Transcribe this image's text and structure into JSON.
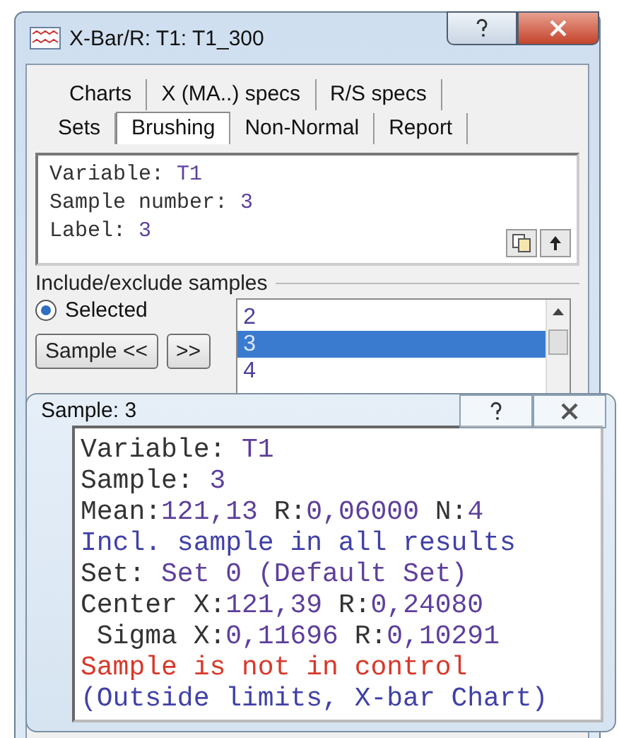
{
  "window": {
    "title": "X-Bar/R: T1: T1_300"
  },
  "tab_rows": [
    {
      "tabs": [
        {
          "label": "Charts",
          "selected": false
        },
        {
          "label": "X (MA..) specs",
          "selected": false
        },
        {
          "label": "R/S specs",
          "selected": false
        }
      ]
    },
    {
      "tabs": [
        {
          "label": "Sets",
          "selected": false
        },
        {
          "label": "Brushing",
          "selected": true
        },
        {
          "label": "Non-Normal",
          "selected": false
        },
        {
          "label": "Report",
          "selected": false
        }
      ]
    }
  ],
  "info": [
    [
      {
        "text": "Variable: ",
        "kind": "label"
      },
      {
        "text": "T1",
        "kind": "value"
      }
    ],
    [
      {
        "text": "Sample number: ",
        "kind": "label"
      },
      {
        "text": "3",
        "kind": "value"
      }
    ],
    [
      {
        "text": "Label: ",
        "kind": "label"
      },
      {
        "text": "3",
        "kind": "value"
      }
    ]
  ],
  "group": {
    "title": "Include/exclude samples",
    "radio": {
      "label": "Selected",
      "selected": true
    },
    "buttons": [
      "Sample <<",
      ">>"
    ],
    "list": [
      {
        "label": "2",
        "selected": false
      },
      {
        "label": "3",
        "selected": true
      },
      {
        "label": "4",
        "selected": false
      }
    ]
  },
  "popup": {
    "title": "Sample: 3",
    "lines": [
      [
        {
          "text": "Variable: ",
          "kind": "label"
        },
        {
          "text": "T1",
          "kind": "value"
        }
      ],
      [
        {
          "text": "Sample: ",
          "kind": "label"
        },
        {
          "text": "3",
          "kind": "value"
        }
      ],
      [
        {
          "text": "Mean:",
          "kind": "label"
        },
        {
          "text": "121,13 ",
          "kind": "value"
        },
        {
          "text": "R:",
          "kind": "label"
        },
        {
          "text": "0,06000 ",
          "kind": "value"
        },
        {
          "text": "N:",
          "kind": "label"
        },
        {
          "text": "4",
          "kind": "value"
        }
      ],
      [
        {
          "text": "Incl. sample in all results",
          "kind": "note"
        }
      ],
      [
        {
          "text": "Set: ",
          "kind": "label"
        },
        {
          "text": "Set 0 (Default Set)",
          "kind": "value"
        }
      ],
      [
        {
          "text": "Center X:",
          "kind": "label"
        },
        {
          "text": "121,39 ",
          "kind": "value"
        },
        {
          "text": "R:",
          "kind": "label"
        },
        {
          "text": "0,24080",
          "kind": "value"
        }
      ],
      [
        {
          "text": " Sigma X:",
          "kind": "label"
        },
        {
          "text": "0,11696 ",
          "kind": "value"
        },
        {
          "text": "R:",
          "kind": "label"
        },
        {
          "text": "0,10291",
          "kind": "value"
        }
      ],
      [
        {
          "text": "Sample is not in control",
          "kind": "alert"
        }
      ],
      [
        {
          "text": "(Outside limits, X-bar Chart)",
          "kind": "note"
        }
      ]
    ]
  }
}
